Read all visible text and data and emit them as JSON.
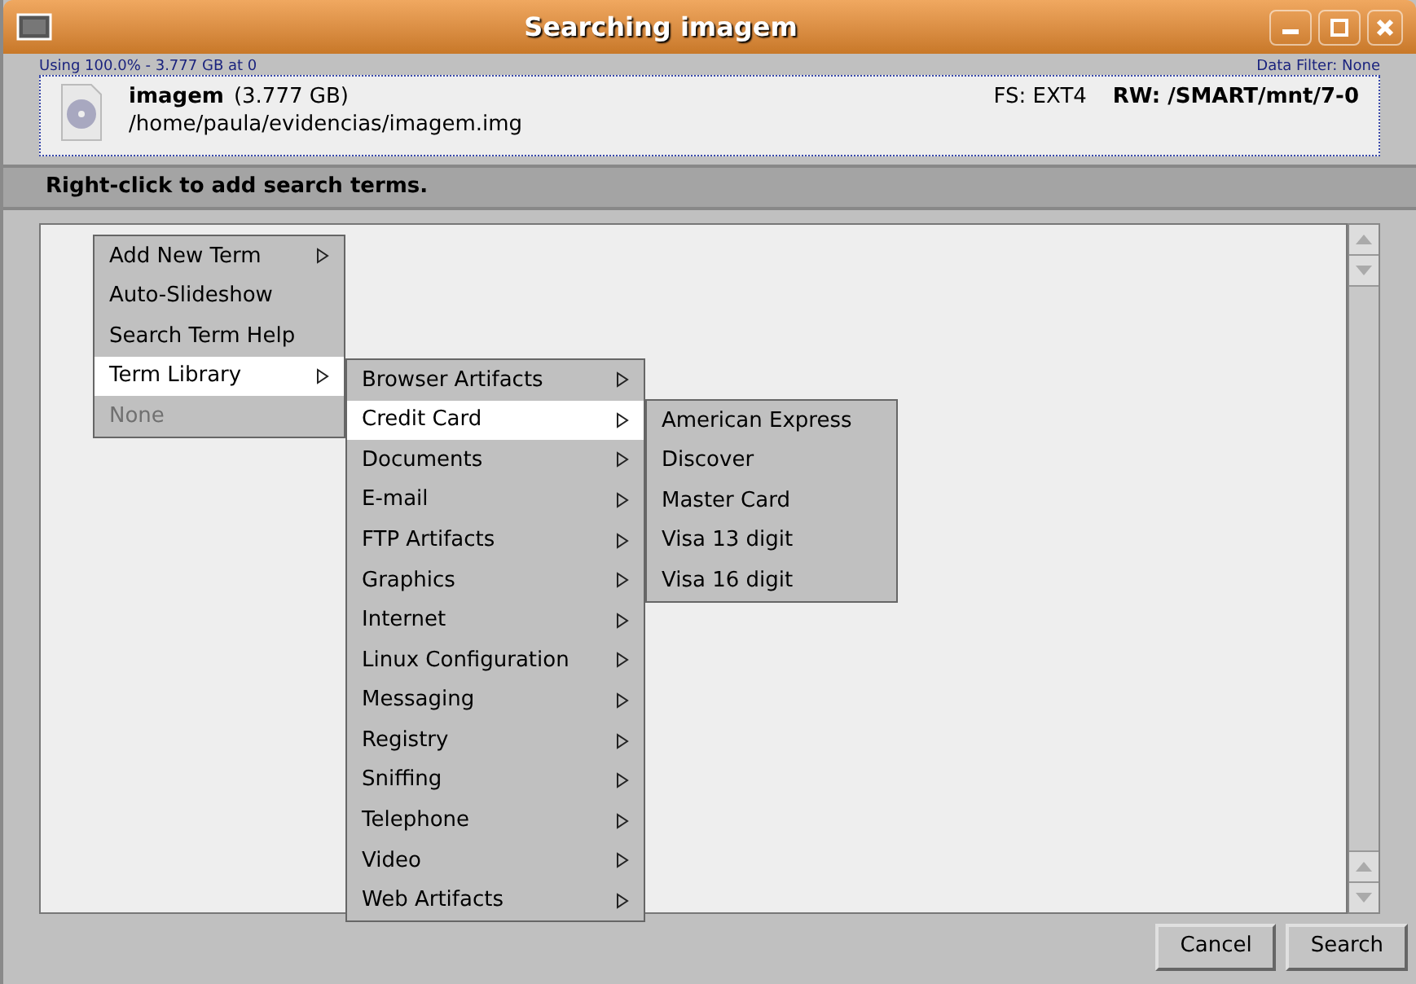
{
  "window": {
    "title": "Searching imagem"
  },
  "info": {
    "usage": "Using 100.0% - 3.777 GB at 0",
    "data_filter": "Data Filter: None",
    "image_name": "imagem",
    "image_size": "(3.777 GB)",
    "image_path": "/home/paula/evidencias/imagem.img",
    "fs": "FS: EXT4",
    "rw": "RW: /SMART/mnt/7-0"
  },
  "hint": "Right-click to add search terms.",
  "menus": [
    {
      "items": [
        {
          "label": "Add New Term",
          "submenu": true,
          "selected": false,
          "disabled": false
        },
        {
          "label": "Auto-Slideshow",
          "submenu": false,
          "selected": false,
          "disabled": false
        },
        {
          "label": "Search Term Help",
          "submenu": false,
          "selected": false,
          "disabled": false
        },
        {
          "label": "Term Library",
          "submenu": true,
          "selected": true,
          "disabled": false
        },
        {
          "label": "None",
          "submenu": false,
          "selected": false,
          "disabled": true
        }
      ]
    },
    {
      "items": [
        {
          "label": "Browser Artifacts",
          "submenu": true,
          "selected": false,
          "disabled": false
        },
        {
          "label": "Credit Card",
          "submenu": true,
          "selected": true,
          "disabled": false
        },
        {
          "label": "Documents",
          "submenu": true,
          "selected": false,
          "disabled": false
        },
        {
          "label": "E-mail",
          "submenu": true,
          "selected": false,
          "disabled": false
        },
        {
          "label": "FTP Artifacts",
          "submenu": true,
          "selected": false,
          "disabled": false
        },
        {
          "label": "Graphics",
          "submenu": true,
          "selected": false,
          "disabled": false
        },
        {
          "label": "Internet",
          "submenu": true,
          "selected": false,
          "disabled": false
        },
        {
          "label": "Linux Configuration",
          "submenu": true,
          "selected": false,
          "disabled": false
        },
        {
          "label": "Messaging",
          "submenu": true,
          "selected": false,
          "disabled": false
        },
        {
          "label": "Registry",
          "submenu": true,
          "selected": false,
          "disabled": false
        },
        {
          "label": "Sniffing",
          "submenu": true,
          "selected": false,
          "disabled": false
        },
        {
          "label": "Telephone",
          "submenu": true,
          "selected": false,
          "disabled": false
        },
        {
          "label": "Video",
          "submenu": true,
          "selected": false,
          "disabled": false
        },
        {
          "label": "Web Artifacts",
          "submenu": true,
          "selected": false,
          "disabled": false
        }
      ]
    },
    {
      "items": [
        {
          "label": "American Express",
          "submenu": false,
          "selected": false,
          "disabled": false
        },
        {
          "label": "Discover",
          "submenu": false,
          "selected": false,
          "disabled": false
        },
        {
          "label": "Master Card",
          "submenu": false,
          "selected": false,
          "disabled": false
        },
        {
          "label": "Visa 13 digit",
          "submenu": false,
          "selected": false,
          "disabled": false
        },
        {
          "label": "Visa 16 digit",
          "submenu": false,
          "selected": false,
          "disabled": false
        }
      ]
    }
  ],
  "buttons": [
    "Cancel",
    "Search"
  ]
}
